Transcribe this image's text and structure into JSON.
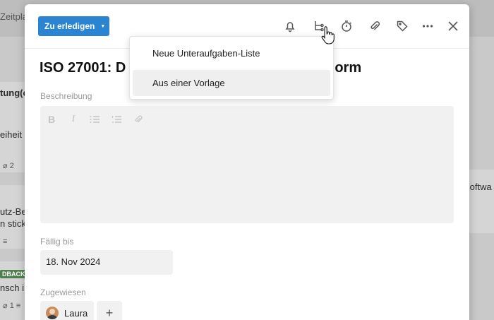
{
  "background": {
    "tab_partial": "Zeitpla",
    "fragments": [
      "tung(c",
      "eiheit",
      "utz-Be",
      "n stick",
      "Softwa",
      "nsch i"
    ],
    "badge": "DBACK",
    "count_a": "2",
    "count_b": "1"
  },
  "modal": {
    "status_button": "Zu erledigen",
    "title": "ISO 27001: D",
    "title_end": "en der Norm",
    "description_label": "Beschreibung",
    "due_label": "Fällig bis",
    "due_date": "18. Nov 2024",
    "assigned_label": "Zugewiesen",
    "assignee_name": "Laura",
    "add_symbol": "+"
  },
  "dropdown": {
    "items": [
      {
        "label": "Neue Unteraufgaben-Liste"
      },
      {
        "label": "Aus einer Vorlage"
      }
    ]
  },
  "colors": {
    "accent": "#2a84d2",
    "hover_row": "#efefef",
    "field_bg": "#f1f1f1"
  },
  "icons": [
    "bell-icon",
    "subtasks-icon",
    "timer-icon",
    "paperclip-icon",
    "tag-icon",
    "more-icon",
    "close-icon"
  ]
}
